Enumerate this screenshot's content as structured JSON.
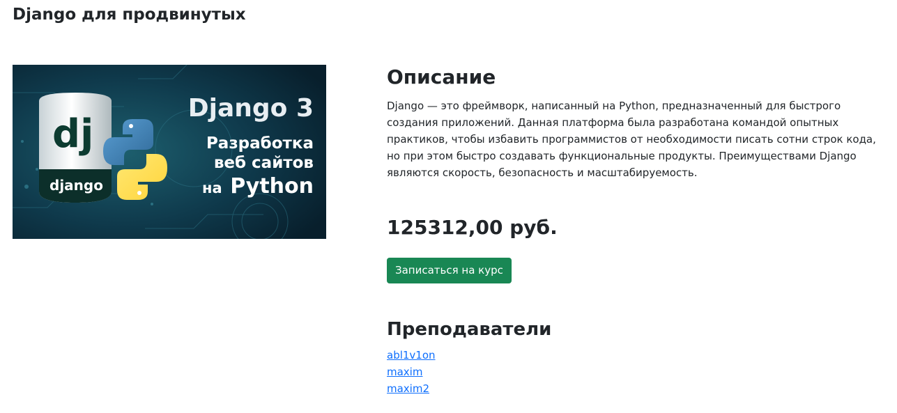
{
  "page": {
    "title": "Django для продвинутых"
  },
  "course_image": {
    "badge_large": "dj",
    "badge_small": "django",
    "headline": "Django 3",
    "subtitle_line1": "Разработка",
    "subtitle_line2": "веб сайтов",
    "subtitle_line3_prefix": "на",
    "subtitle_line3_word": "Python"
  },
  "description": {
    "heading": "Описание",
    "text": "Django — это фреймворк, написанный на Python, предназначенный для быстрого создания приложений. Данная платформа была разработана командой опытных практиков, чтобы избавить программистов от необходимости писать сотни строк кода, но при этом быстро создавать функциональные продукты. Преимуществами Django являются скорость, безопасность и масштабируемость."
  },
  "price": "125312,00 руб.",
  "enroll_button": "Записаться на курс",
  "teachers": {
    "heading": "Преподаватели",
    "items": [
      "abl1v1on",
      "maxim",
      "maxim2"
    ]
  },
  "colors": {
    "button": "#198754",
    "link": "#0d6efd",
    "text": "#212529"
  }
}
